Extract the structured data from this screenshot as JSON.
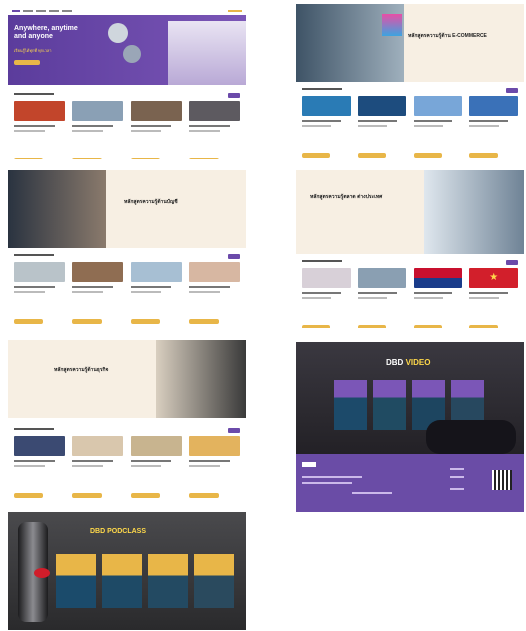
{
  "panels": {
    "p1": {
      "title": "Anywhere, anytime and anyone",
      "subtitle": "เรียนรู้ได้ทุกที่ ทุกเวลา"
    },
    "p2": {
      "title": "หลักสูตรความรู้ด้าน E-COMMERCE"
    },
    "p3": {
      "title": "หลักสูตรความรู้ด้านบัญชี"
    },
    "p4": {
      "title": "หลักสูตรความรู้ตลาด ต่างประเทศ"
    },
    "p5": {
      "title": "หลักสูตรความรู้ด้านธุรกิจ"
    },
    "p6": {
      "title_white": "DBD",
      "title_yellow": "VIDEO"
    },
    "p7": {
      "title": "DBD PODCLASS"
    }
  },
  "colors": {
    "accent": "#6b4aaa",
    "button": "#e8b648",
    "cream": "#f7efe3"
  }
}
